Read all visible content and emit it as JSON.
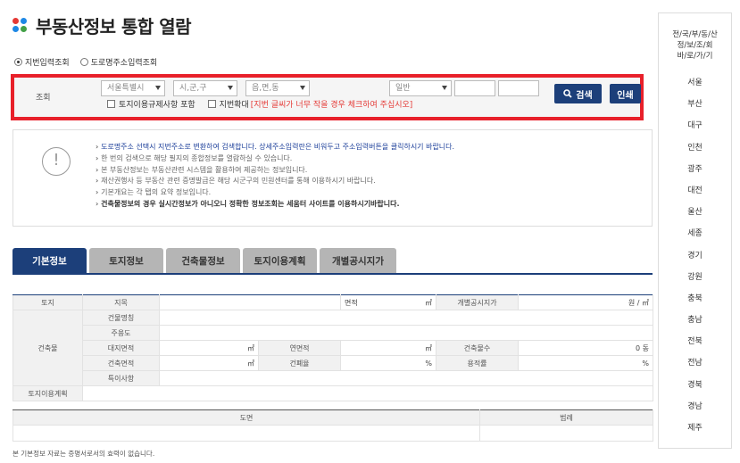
{
  "header": {
    "title": "부동산정보 통합 열람"
  },
  "search_mode": {
    "options": [
      "지번입력조회",
      "도로명주소입력조회"
    ],
    "selected": 0
  },
  "search": {
    "label": "조회",
    "sido": "서울특별시",
    "sigungu": "시,군,구",
    "eupmyeondong": "읍,면,동",
    "type": "일반",
    "check_regulation": "토지이용규제사항 포함",
    "check_enlarge": "지번확대",
    "enlarge_warn": "[지번 글씨가 너무 작을 경우 체크하여 주십시오]",
    "search_btn": "검색",
    "print_btn": "인쇄"
  },
  "info": {
    "items": [
      "도로명주소 선택시 지번주소로 변환하여 검색합니다. 상세주소입력란은 비워두고 주소입력버튼을 클릭하시기 바랍니다.",
      "한 번의 검색으로 해당 필지의 종합정보를 열람하실 수 있습니다.",
      "본 부동산정보는 부동산관련 시스템을 활용하여 제공하는 정보입니다.",
      "재산권행사 등 부동산 관련 증명발급은 해당 시군구의 민원센터를 통해 이용하시기 바랍니다.",
      "기본개요는 각 탭의 요약 정보입니다.",
      "건축물정보의 경우 실시간정보가 아니오니 정확한 정보조회는 세움터 사이트를 이용하시기바랍니다."
    ]
  },
  "tabs": [
    "기본정보",
    "토지정보",
    "건축물정보",
    "토지이용계획",
    "개별공시지가"
  ],
  "table": {
    "land": "토지",
    "jimok": "지목",
    "area": "면적",
    "unit_m2": "㎡",
    "official_price": "개별공시지가",
    "price_unit": "원 / ㎡",
    "building": "건축물",
    "bldg_name": "건물명칭",
    "main_use": "주용도",
    "site_area": "대지면적",
    "total_area": "연면적",
    "floors": "건축물수",
    "floors_value": "0 동",
    "bldg_area": "건축면적",
    "coverage": "건폐율",
    "far": "용적률",
    "percent": "%",
    "special": "특이사항",
    "land_use_plan": "토지이용계획"
  },
  "table2": {
    "drawing": "도면",
    "legend": "범례"
  },
  "footnote": "본 기본정보 자료는 증명서로서의 효력이 없습니다.",
  "side": {
    "heading": [
      "전/국/부/동/산",
      "정/보/조/회",
      "바/로/가/기"
    ],
    "regions": [
      "서울",
      "부산",
      "대구",
      "인천",
      "광주",
      "대전",
      "울산",
      "세종",
      "경기",
      "강원",
      "충북",
      "충남",
      "전북",
      "전남",
      "경북",
      "경남",
      "제주"
    ]
  }
}
